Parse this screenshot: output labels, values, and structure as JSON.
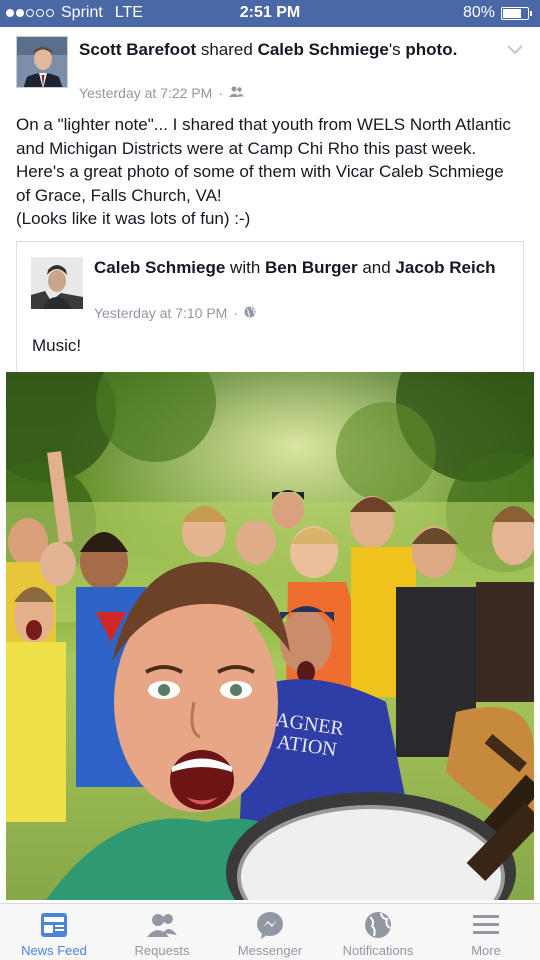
{
  "status_bar": {
    "carrier": "Sprint",
    "network": "LTE",
    "time": "2:51 PM",
    "battery": "80%",
    "battery_level": 0.8,
    "signal_bars": 2
  },
  "post": {
    "author": "Scott Barefoot",
    "action": " shared ",
    "original_author": "Caleb Schmiege",
    "possessive_suffix": "'s",
    "object": "photo.",
    "timestamp": "Yesterday at 7:22 PM",
    "privacy_icon": "friends-icon",
    "text": "On a \"lighter note\"... I shared that youth from WELS North Atlantic and Michigan Districts were at Camp Chi Rho this past week.  Here's a great photo of some of them with Vicar Caleb Schmiege of Grace, Falls Church, VA!",
    "text_line2": "(Looks like it was lots of fun) :-)"
  },
  "shared": {
    "author": "Caleb Schmiege",
    "with_word": " with ",
    "tag1": "Ben Burger",
    "and_word": " and ",
    "tag2": "Jacob Reich",
    "timestamp": "Yesterday at 7:10 PM",
    "privacy_icon": "globe-icon",
    "caption": "Music!"
  },
  "photo": {
    "shirt_text": "AGNER\nATION"
  },
  "tab_bar": {
    "items": [
      {
        "label": "News Feed",
        "icon": "news-feed-icon",
        "active": true
      },
      {
        "label": "Requests",
        "icon": "friend-requests-icon",
        "active": false
      },
      {
        "label": "Messenger",
        "icon": "messenger-icon",
        "active": false
      },
      {
        "label": "Notifications",
        "icon": "globe-icon",
        "active": false
      },
      {
        "label": "More",
        "icon": "menu-icon",
        "active": false
      }
    ]
  },
  "colors": {
    "status_bar": "#4a67a6",
    "tab_active": "#4b84d8",
    "tab_inactive": "#9197a3",
    "meta_text": "#9197a3"
  }
}
